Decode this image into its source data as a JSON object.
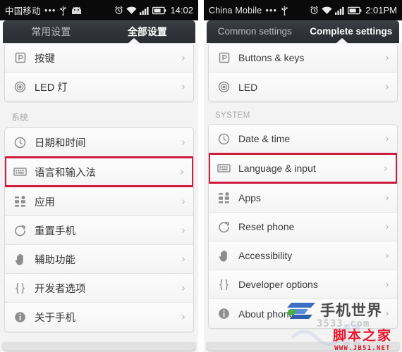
{
  "screens": [
    {
      "id": "left-cn",
      "lang": "cn",
      "statusbar": {
        "carrier": "中国移动",
        "dots": "•••",
        "usb_icon": "usb-icon",
        "face_icon": "android-face-icon",
        "alarm_icon": "alarm-icon",
        "wifi_icon": "wifi-icon",
        "signal_icon": "signal-bars-icon",
        "battery_icon": "battery-icon",
        "time": "14:02"
      },
      "tabs": [
        {
          "label": "常用设置",
          "active": false
        },
        {
          "label": "全部设置",
          "active": true
        }
      ],
      "groups": [
        {
          "section": null,
          "rows": [
            {
              "icon": "buttons-keys-icon",
              "label": "按键",
              "chevron": "›",
              "highlight": false
            },
            {
              "icon": "led-icon",
              "label": "LED 灯",
              "chevron": "›",
              "highlight": false
            }
          ]
        },
        {
          "section": "系统",
          "rows": [
            {
              "icon": "clock-icon",
              "label": "日期和时间",
              "chevron": "›",
              "highlight": false
            },
            {
              "icon": "keyboard-icon",
              "label": "语言和输入法",
              "chevron": "›",
              "highlight": true
            },
            {
              "icon": "apps-grid-icon",
              "label": "应用",
              "chevron": "›",
              "highlight": false
            },
            {
              "icon": "reset-icon",
              "label": "重置手机",
              "chevron": "›",
              "highlight": false
            },
            {
              "icon": "hand-icon",
              "label": "辅助功能",
              "chevron": "›",
              "highlight": false
            },
            {
              "icon": "braces-icon",
              "label": "开发者选项",
              "chevron": "›",
              "highlight": false
            },
            {
              "icon": "info-icon",
              "label": "关于手机",
              "chevron": "›",
              "highlight": false
            }
          ]
        }
      ]
    },
    {
      "id": "right-en",
      "lang": "en",
      "statusbar": {
        "carrier": "China Mobile",
        "dots": "•••",
        "usb_icon": "usb-icon",
        "face_icon": "android-face-icon",
        "alarm_icon": "alarm-icon",
        "wifi_icon": "wifi-icon",
        "signal_icon": "signal-bars-icon",
        "battery_icon": "battery-icon",
        "time": "2:01PM"
      },
      "tabs": [
        {
          "label": "Common settings",
          "active": false
        },
        {
          "label": "Complete settings",
          "active": true
        }
      ],
      "groups": [
        {
          "section": null,
          "rows": [
            {
              "icon": "buttons-keys-icon",
              "label": "Buttons & keys",
              "chevron": "›",
              "highlight": false
            },
            {
              "icon": "led-icon",
              "label": "LED",
              "chevron": "›",
              "highlight": false
            }
          ]
        },
        {
          "section": "SYSTEM",
          "rows": [
            {
              "icon": "clock-icon",
              "label": "Date & time",
              "chevron": "›",
              "highlight": false
            },
            {
              "icon": "keyboard-icon",
              "label": "Language & input",
              "chevron": "›",
              "highlight": true
            },
            {
              "icon": "apps-grid-icon",
              "label": "Apps",
              "chevron": "›",
              "highlight": false
            },
            {
              "icon": "reset-icon",
              "label": "Reset phone",
              "chevron": "›",
              "highlight": false
            },
            {
              "icon": "hand-icon",
              "label": "Accessibility",
              "chevron": "›",
              "highlight": false
            },
            {
              "icon": "braces-icon",
              "label": "Developer options",
              "chevron": "›",
              "highlight": false
            },
            {
              "icon": "info-icon",
              "label": "About phone",
              "chevron": "›",
              "highlight": false
            }
          ]
        }
      ]
    }
  ],
  "watermarks": {
    "logo_text": "手机世界",
    "logo_sub": "3533.com",
    "jb_text": "脚本之家",
    "jb_url": "WWW.JB51.NET"
  },
  "colors": {
    "highlight_red": "#cf1b3f",
    "status_bar_bg": "#0a0a0a",
    "tab_bar_bg": "#303338",
    "page_bg": "#f3f3f3",
    "row_text": "#3a3a3a",
    "jb_red": "#e8132b"
  }
}
